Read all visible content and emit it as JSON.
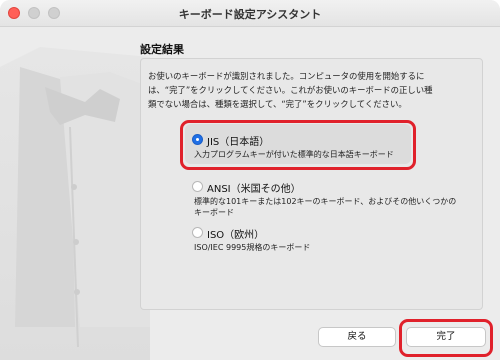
{
  "window": {
    "title": "キーボード設定アシスタント"
  },
  "section": {
    "title": "設定結果"
  },
  "description": {
    "line1": "お使いのキーボードが識別されました。コンピュータの使用を開始するに",
    "line2": "は、“完了”をクリックしてください。これがお使いのキーボードの正しい種",
    "line3": "類でない場合は、種類を選択して、“完了”をクリックしてください。"
  },
  "options": [
    {
      "label": "JIS（日本語）",
      "sub1": "入力プログラムキーが付いた標準的な日本語キーボード",
      "sub2": "",
      "selected": true
    },
    {
      "label": "ANSI（米国その他）",
      "sub1": "標準的な101キーまたは102キーのキーボード、およびその他いくつかの",
      "sub2": "キーボード",
      "selected": false
    },
    {
      "label": "ISO（欧州）",
      "sub1": "ISO/IEC 9995規格のキーボード",
      "sub2": "",
      "selected": false
    }
  ],
  "buttons": {
    "back": "戻る",
    "done": "完了"
  },
  "colors": {
    "accent": "#1f6fe6",
    "highlight": "#e0212b"
  }
}
